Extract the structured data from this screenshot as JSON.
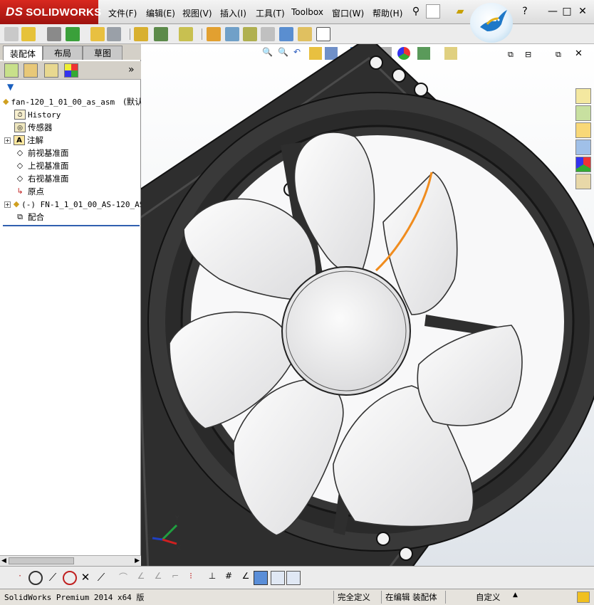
{
  "app": {
    "logo_text": "SOLIDWORKS",
    "logo_prefix": "DS"
  },
  "menu": [
    "文件(F)",
    "编辑(E)",
    "视图(V)",
    "插入(I)",
    "工具(T)",
    "Toolbox",
    "窗口(W)",
    "帮助(H)"
  ],
  "window_controls": {
    "help": "?",
    "minimize": "—",
    "restore": "□",
    "close": "✕"
  },
  "tabs": [
    "装配体",
    "布局",
    "草图"
  ],
  "tree": {
    "root": "fan-120_1_01_00_as_asm",
    "root_suffix": "(默认",
    "items": [
      "History",
      "传感器",
      "注解",
      "前视基准面",
      "上视基准面",
      "右视基准面",
      "原点",
      "(-) FN-1_1_01_00_AS-120_AS",
      "配合"
    ]
  },
  "panel": {
    "expand": "»"
  },
  "triad": {
    "x": "X",
    "y": "Y",
    "z": "Z"
  },
  "status": {
    "product": "SolidWorks Premium 2014 x64 版",
    "definition": "完全定义",
    "mode": "在编辑 装配体",
    "units": "自定义"
  },
  "colors": {
    "accent": "#c41e16",
    "selection": "#f08c1e",
    "frame": "#2a2a2a",
    "blade": "#f4f4f4"
  }
}
